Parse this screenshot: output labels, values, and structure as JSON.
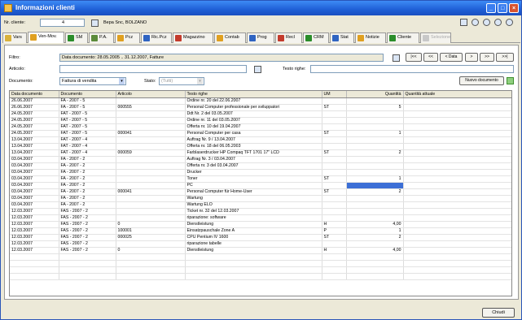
{
  "window": {
    "title": "Informazioni clienti"
  },
  "header": {
    "client_label": "Nr. cliente:",
    "client_number": "4",
    "client_name": "Bepa Snc, BOLZANO"
  },
  "tabs": [
    {
      "label": "Vars",
      "color": "#d9b13a"
    },
    {
      "label": "Ven-Mov.",
      "color": "#e0a020"
    },
    {
      "label": "SM",
      "color": "#2a8d2a"
    },
    {
      "label": "P.A.",
      "color": "#5b8b3a"
    },
    {
      "label": "Pcz",
      "color": "#e0a020"
    },
    {
      "label": "Ric.Pcz",
      "color": "#2f64c2"
    },
    {
      "label": "Magazzino",
      "color": "#c43b2c"
    },
    {
      "label": "Contab",
      "color": "#e0a020"
    },
    {
      "label": "Prog",
      "color": "#2f64c2"
    },
    {
      "label": "Recl",
      "color": "#c43b2c"
    },
    {
      "label": "CRM",
      "color": "#2a8d2a"
    },
    {
      "label": "Stat",
      "color": "#2f64c2"
    },
    {
      "label": "Notizie",
      "color": "#e0a020"
    },
    {
      "label": "Cliente",
      "color": "#2a8d2a"
    },
    {
      "label": "Selezione",
      "color": "#c8c8c8"
    }
  ],
  "filter": {
    "filter_label": "Filtro:",
    "filter_value": "Data documento: 28.05.2005 .. 31.12.2007, Fatture",
    "article_label": "Articolo:",
    "article_value": "",
    "testo_label": "Testo righe:",
    "testo_value": "",
    "document_label": "Documento:",
    "document_value": "Fattura di vendita",
    "stato_label": "Stato:",
    "stato_value": "(Tutti)",
    "new_document": "Nuovo documento",
    "nav_date": "Data"
  },
  "table": {
    "columns": [
      "Data documento",
      "Documento",
      "Articolo",
      "Testo righe",
      "UM",
      "Quantità",
      "Quantità attuale"
    ],
    "rows": [
      [
        "26.06.2007",
        "FA - 2007 - 5",
        "",
        "Ordine nr. 20 del 22.06.2007",
        "",
        "",
        ""
      ],
      [
        "26.06.2007",
        "FA - 2007 - 5",
        "000555",
        "Personal Computer professionale per sviluppatori",
        "ST",
        "5",
        ""
      ],
      [
        "24.05.2007",
        "FAT - 2007 - 5",
        "",
        "Ddt Nr. 2 del 03.05.2007",
        "",
        "",
        ""
      ],
      [
        "24.05.2007",
        "FAT - 2007 - 5",
        "",
        "Ordine nr. 11 del 03.05.2007",
        "",
        "",
        ""
      ],
      [
        "24.05.2007",
        "FAT - 2007 - 5",
        "",
        "Offerta nr. 10 del 19.04.2007",
        "",
        "",
        ""
      ],
      [
        "24.05.2007",
        "FAT - 2007 - 5",
        "000041",
        "Personal Computer per casa",
        "ST",
        "1",
        ""
      ],
      [
        "13.04.2007",
        "FAT - 2007 - 4",
        "",
        "Auftrag Nr. 9 / 13.04.2007",
        "",
        "",
        ""
      ],
      [
        "13.04.2007",
        "FAT - 2007 - 4",
        "",
        "Offerta nr. 18 del 06.05.2003",
        "",
        "",
        ""
      ],
      [
        "13.04.2007",
        "FAT - 2007 - 4",
        "000059",
        "Farblaserdrucker HP Compaq TFT 1701 17\" LCD",
        "ST",
        "2",
        ""
      ],
      [
        "03.04.2007",
        "FA - 2007 - 2",
        "",
        "Auftrag Nr. 3 / 03.04.2007",
        "",
        "",
        ""
      ],
      [
        "03.04.2007",
        "FA - 2007 - 2",
        "",
        "Offerta nr. 3 del 03.04.2007",
        "",
        "",
        ""
      ],
      [
        "03.04.2007",
        "FA - 2007 - 2",
        "",
        "Drucker",
        "",
        "",
        ""
      ],
      [
        "03.04.2007",
        "FA - 2007 - 2",
        "",
        "Toner",
        "ST",
        "1",
        ""
      ],
      [
        "03.04.2007",
        "FA - 2007 - 2",
        "",
        "PC",
        "",
        "",
        ""
      ],
      [
        "03.04.2007",
        "FA - 2007 - 2",
        "000041",
        "Personal Computer für Home-User",
        "ST",
        "2",
        ""
      ],
      [
        "03.04.2007",
        "FA - 2007 - 2",
        "",
        "Wartung",
        "",
        "",
        ""
      ],
      [
        "03.04.2007",
        "FA - 2007 - 2",
        "",
        "Wartung ELO",
        "",
        "",
        ""
      ],
      [
        "12.03.2007",
        "FAS - 2007 - 2",
        "",
        "Ticket nr. 32 del 12.03.2007",
        "",
        "",
        ""
      ],
      [
        "12.03.2007",
        "FAS - 2007 - 2",
        "",
        "riparazione: software",
        "",
        "",
        ""
      ],
      [
        "12.03.2007",
        "FAS - 2007 - 2",
        "0",
        "Dienstleistung",
        "H",
        "4,00",
        ""
      ],
      [
        "12.03.2007",
        "FAS - 2007 - 2",
        "100001",
        "Einsatzpauschale Zone A",
        "P",
        "1",
        ""
      ],
      [
        "12.03.2007",
        "FAS - 2007 - 2",
        "000025",
        "CPU Pentium IV 1600",
        "ST",
        "2",
        ""
      ],
      [
        "12.03.2007",
        "FAS - 2007 - 2",
        "",
        "riparazione tabelle",
        "",
        "",
        ""
      ],
      [
        "12.03.2007",
        "FAS - 2007 - 2",
        "0",
        "Dienstleistung",
        "H",
        "4,00",
        ""
      ]
    ],
    "selected_row": 13,
    "selected_col": 5
  },
  "footer": {
    "close_label": "Chiudi"
  }
}
